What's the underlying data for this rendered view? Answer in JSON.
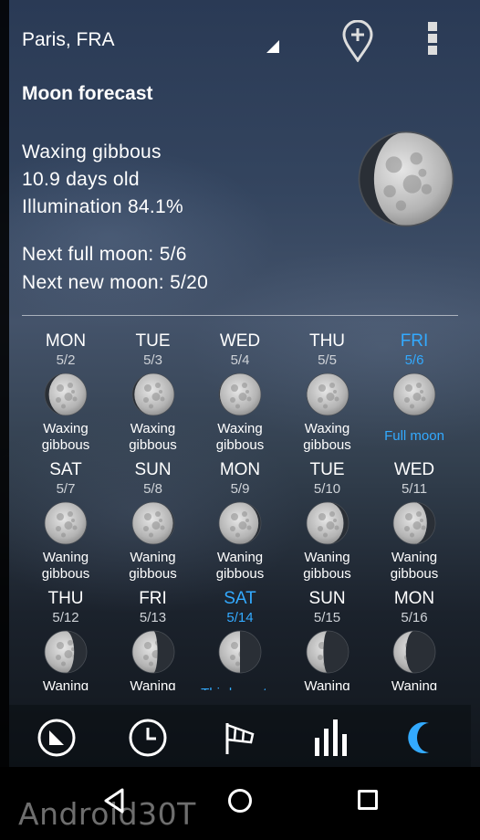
{
  "header": {
    "location": "Paris, FRA",
    "pin_icon": "add-location-pin-icon",
    "menu_icon": "overflow-menu-icon"
  },
  "forecast": {
    "title": "Moon forecast",
    "phase": "Waxing gibbous",
    "age": "10.9 days old",
    "illumination": "Illumination 84.1%",
    "next_full": "Next full moon: 5/6",
    "next_new": "Next new moon: 5/20",
    "illumination_fraction": 0.841
  },
  "days": [
    {
      "name": "MON",
      "date": "5/2",
      "label": "Waxing gibbous",
      "illum": 0.9,
      "waxing": true,
      "highlight": false
    },
    {
      "name": "TUE",
      "date": "5/3",
      "label": "Waxing gibbous",
      "illum": 0.95,
      "waxing": true,
      "highlight": false
    },
    {
      "name": "WED",
      "date": "5/4",
      "label": "Waxing gibbous",
      "illum": 0.98,
      "waxing": true,
      "highlight": false
    },
    {
      "name": "THU",
      "date": "5/5",
      "label": "Waxing gibbous",
      "illum": 0.99,
      "waxing": true,
      "highlight": false
    },
    {
      "name": "FRI",
      "date": "5/6",
      "label": "Full moon",
      "illum": 1.0,
      "waxing": true,
      "highlight": true
    },
    {
      "name": "SAT",
      "date": "5/7",
      "label": "Waning gibbous",
      "illum": 0.99,
      "waxing": false,
      "highlight": false
    },
    {
      "name": "SUN",
      "date": "5/8",
      "label": "Waning gibbous",
      "illum": 0.97,
      "waxing": false,
      "highlight": false
    },
    {
      "name": "MON",
      "date": "5/9",
      "label": "Waning gibbous",
      "illum": 0.94,
      "waxing": false,
      "highlight": false
    },
    {
      "name": "TUE",
      "date": "5/10",
      "label": "Waning gibbous",
      "illum": 0.88,
      "waxing": false,
      "highlight": false
    },
    {
      "name": "WED",
      "date": "5/11",
      "label": "Waning gibbous",
      "illum": 0.8,
      "waxing": false,
      "highlight": false
    },
    {
      "name": "THU",
      "date": "5/12",
      "label": "Waning",
      "illum": 0.7,
      "waxing": false,
      "highlight": false
    },
    {
      "name": "FRI",
      "date": "5/13",
      "label": "Waning",
      "illum": 0.6,
      "waxing": false,
      "highlight": false
    },
    {
      "name": "SAT",
      "date": "5/14",
      "label": "Third quarter",
      "illum": 0.5,
      "waxing": false,
      "highlight": true
    },
    {
      "name": "SUN",
      "date": "5/15",
      "label": "Waning",
      "illum": 0.4,
      "waxing": false,
      "highlight": false
    },
    {
      "name": "MON",
      "date": "5/16",
      "label": "Waning",
      "illum": 0.3,
      "waxing": false,
      "highlight": false
    }
  ],
  "bottom_nav": [
    {
      "icon": "current-conditions-icon",
      "active": false
    },
    {
      "icon": "hourly-clock-icon",
      "active": false
    },
    {
      "icon": "wind-sock-icon",
      "active": false
    },
    {
      "icon": "bar-chart-icon",
      "active": false
    },
    {
      "icon": "moon-crescent-icon",
      "active": true
    }
  ],
  "colors": {
    "accent": "#33aaff",
    "text": "#ffffff",
    "subtext": "#cfd3d8"
  },
  "system_nav": {
    "back_icon": "back-triangle-icon",
    "home_icon": "home-circle-icon",
    "recents_icon": "recents-square-icon"
  },
  "watermark": "Android30T"
}
